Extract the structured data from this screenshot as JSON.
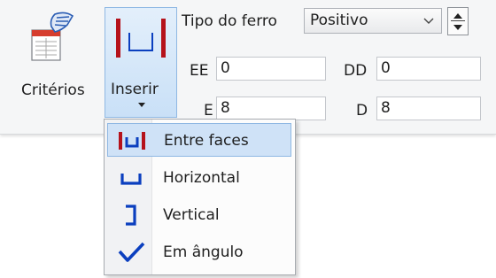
{
  "ribbon": {
    "criterios_label": "Critérios",
    "inserir_label": "Inserir",
    "tipo_label": "Tipo do ferro",
    "tipo_value": "Positivo",
    "ee_label": "EE",
    "ee_value": "0",
    "dd_label": "DD",
    "dd_value": "0",
    "e_label": "E",
    "e_value": "8",
    "d_label": "D",
    "d_value": "8"
  },
  "menu": {
    "items": [
      {
        "label": "Entre faces",
        "icon": "entre-faces-icon"
      },
      {
        "label": "Horizontal",
        "icon": "horizontal-icon"
      },
      {
        "label": "Vertical",
        "icon": "vertical-icon"
      },
      {
        "label": "Em ângulo",
        "icon": "angle-icon"
      }
    ]
  },
  "colors": {
    "accent_red": "#b5121b",
    "accent_blue": "#0b3fbf",
    "highlight": "#cfe2f7"
  }
}
